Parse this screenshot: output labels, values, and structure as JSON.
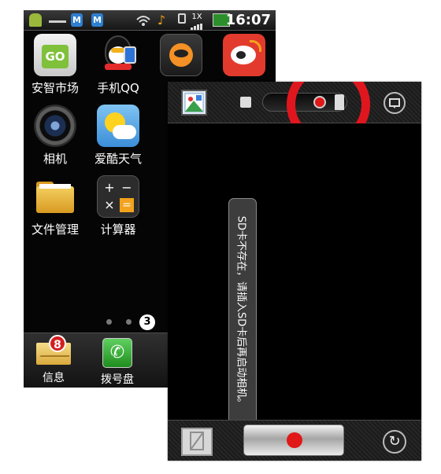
{
  "statusbar": {
    "icons": [
      "android-icon",
      "usb-icon",
      "m-app-icon",
      "m-app-icon",
      "wifi-icon",
      "music-icon",
      "battery-icon",
      "signal-icon",
      "chart-icon"
    ],
    "m_badges": [
      "M",
      "M"
    ],
    "network": "1X",
    "time": "16:07"
  },
  "home": {
    "apps": [
      {
        "label": "安智市场",
        "icon": "market-bag-icon"
      },
      {
        "label": "手机QQ",
        "icon": "qq-penguin-icon"
      },
      {
        "label": "",
        "icon": "orange-face-icon"
      },
      {
        "label": "",
        "icon": "weibo-icon"
      },
      {
        "label": "相机",
        "icon": "camera-lens-icon"
      },
      {
        "label": "爱酷天气",
        "icon": "weather-sun-icon"
      },
      {
        "label": "文件管理",
        "icon": "folder-icon"
      },
      {
        "label": "计算器",
        "icon": "calculator-icon"
      }
    ],
    "page_indicator": "3",
    "dock": [
      {
        "label": "信息",
        "icon": "envelope-icon",
        "badge": "8"
      },
      {
        "label": "拨号盘",
        "icon": "phone-icon"
      }
    ]
  },
  "camera": {
    "toast": "SD卡不存在，请插入SD卡后再启动相机。",
    "mode": "video",
    "colors": {
      "accent": "#e0161e",
      "record": "#e01818"
    }
  }
}
